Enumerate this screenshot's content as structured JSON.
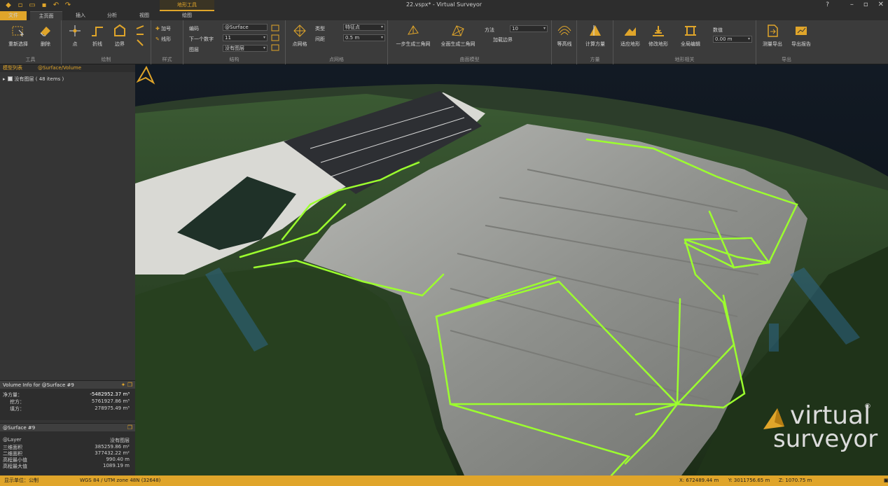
{
  "titlebar": {
    "window_title": "22.vspx* - Virtual Surveyor",
    "context_tab": "地形工具"
  },
  "tabs": {
    "file": "文件",
    "home": "主页面",
    "insert": "插入",
    "analyze": "分析",
    "view": "视图",
    "draw": "绘图"
  },
  "ribbon": {
    "tools": {
      "label": "工具",
      "reshape": "重新选择",
      "delete": "删除"
    },
    "draw": {
      "label": "绘制",
      "point": "点",
      "polyline": "折线",
      "polygon": "边界"
    },
    "style": {
      "label": "样式",
      "add": "加号",
      "line": "线形"
    },
    "structure": {
      "label": "结构",
      "code_label": "编码",
      "code_value": "@Surface",
      "next_code_label": "下一个数字",
      "next_code_value": "11",
      "layer_label": "图层",
      "layer_value": "没有图层"
    },
    "tin": {
      "label": "点网格",
      "btn": "点网格",
      "type_label": "类型",
      "type_value": "特征点",
      "spacing_label": "间距",
      "spacing_value": "0.5 m"
    },
    "surface_model": {
      "label": "曲面模型",
      "onestep": "一步生成三角网",
      "full": "全面生成三角网",
      "method_label": "方法",
      "method_value": "10",
      "add_boundary": "加载边界"
    },
    "contours": {
      "label": "等高线",
      "btn": "等高线"
    },
    "volume": {
      "label": "方量",
      "btn": "计算方量"
    },
    "terrain": {
      "label": "地形相关",
      "fit": "适应地形",
      "modify": "修改地形",
      "full": "全局编辑",
      "quantity_label": "数值",
      "quantity_value": "0.00 m"
    },
    "export": {
      "label": "导出",
      "export_btn": "测量导出",
      "export_report": "导出报告"
    }
  },
  "leftpanel": {
    "tab1": "模型列表",
    "tab2": "@Surface/Volume",
    "layer_item": "没有图层 ( 48 items )",
    "volume_panel": {
      "title": "Volume Info for @Surface #9",
      "rows": [
        {
          "k": "净方量：",
          "v": "-5482952.37 m³"
        },
        {
          "k": "挖方：",
          "v": "5761927.86 m³"
        },
        {
          "k": "填方：",
          "v": "278975.49 m³"
        }
      ]
    },
    "surface_panel": {
      "title": "@Surface #9",
      "rows": [
        {
          "k": "@Layer",
          "v": "没有图层"
        },
        {
          "k": "三维面积",
          "v": "385259.86 m²"
        },
        {
          "k": "二维面积",
          "v": "377432.22 m²"
        },
        {
          "k": "高程最小值",
          "v": "990.40 m"
        },
        {
          "k": "高程最大值",
          "v": "1089.19 m"
        }
      ]
    }
  },
  "logo": {
    "line1": "virtual",
    "line2": "surveyor",
    "reg": "®"
  },
  "statusbar": {
    "unit_label": "显示单位：公制",
    "crs": "WGS 84 / UTM zone 48N (32648)",
    "x": "X: 672489.44 m",
    "y": "Y: 3011756.65 m",
    "z": "Z: 1070.75 m"
  },
  "colors": {
    "accent": "#e0a52a",
    "breakline": "#9cff2e"
  }
}
